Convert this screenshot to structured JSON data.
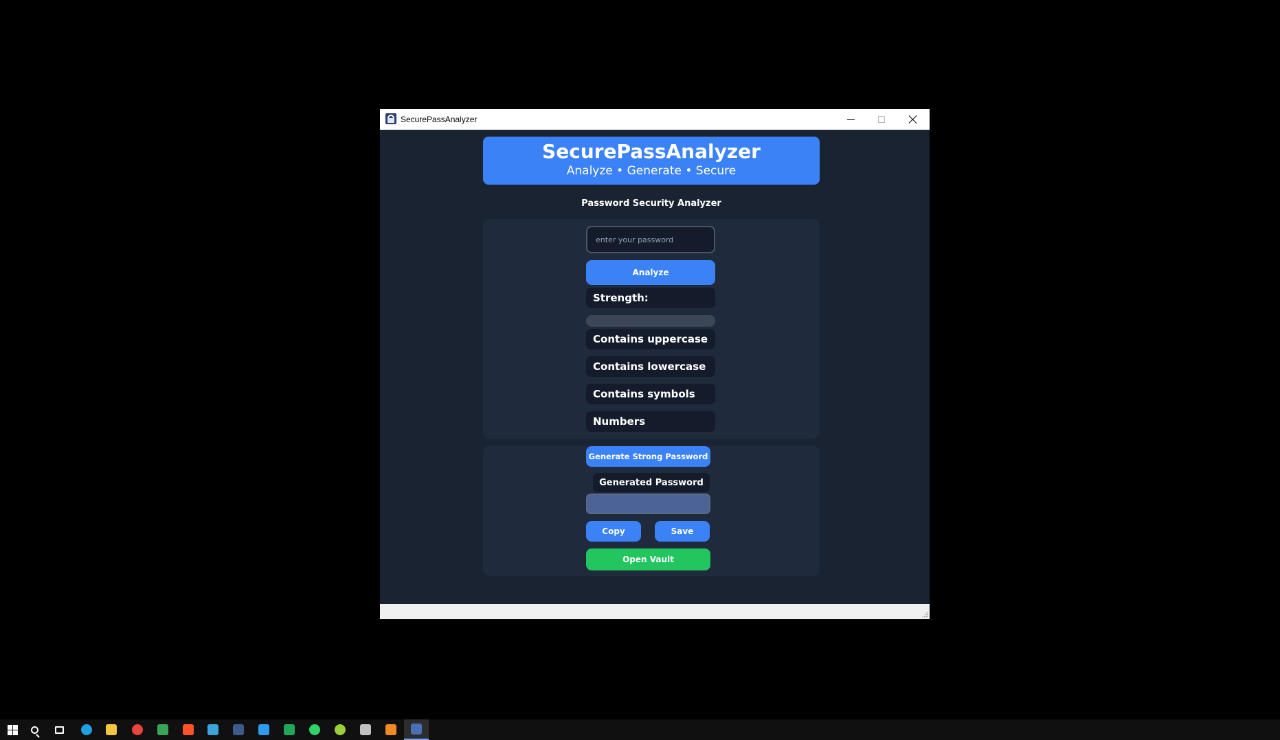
{
  "window": {
    "title": "SecurePassAnalyzer"
  },
  "header": {
    "title": "SecurePassAnalyzer",
    "subtitle": "Analyze • Generate • Secure"
  },
  "analyzer": {
    "section_title": "Password Security Analyzer",
    "password_input": {
      "value": "",
      "placeholder": "enter your password"
    },
    "analyze_label": "Analyze",
    "strength_label": "Strength:",
    "strength_fraction": 0,
    "checks": {
      "uppercase": "Contains uppercase",
      "lowercase": "Contains lowercase",
      "symbols": "Contains symbols",
      "numbers": "Numbers"
    }
  },
  "generator": {
    "generate_label": "Generate Strong Password",
    "generated_label": "Generated Password",
    "generated_value": "",
    "copy_label": "Copy",
    "save_label": "Save",
    "vault_label": "Open Vault"
  },
  "colors": {
    "accent": "#3b82f6",
    "success": "#22c55e",
    "background": "#1a2332",
    "panel": "#1f2a3c"
  },
  "taskbar": {
    "icons": [
      {
        "name": "start-icon",
        "color": "#ffffff"
      },
      {
        "name": "search-icon",
        "color": "#ffffff"
      },
      {
        "name": "task-view-icon",
        "color": "#ffffff"
      },
      {
        "name": "edge-icon",
        "color": "#1fa0e0"
      },
      {
        "name": "file-explorer-icon",
        "color": "#f5c542"
      },
      {
        "name": "chrome-icon",
        "color": "#e8453c"
      },
      {
        "name": "store-icon",
        "color": "#3aa655"
      },
      {
        "name": "brave-icon",
        "color": "#fb542b"
      },
      {
        "name": "vs-installer-icon",
        "color": "#3ea3d8"
      },
      {
        "name": "app-icon",
        "color": "#3c5a8a"
      },
      {
        "name": "vscode-icon",
        "color": "#2f9bf0"
      },
      {
        "name": "qc-icon",
        "color": "#22a65a"
      },
      {
        "name": "whatsapp-icon",
        "color": "#2fd366"
      },
      {
        "name": "green-app-icon",
        "color": "#9ccf3a"
      },
      {
        "name": "database-icon",
        "color": "#c0c0c0"
      },
      {
        "name": "orange-app-icon",
        "color": "#f08a24"
      },
      {
        "name": "securepass-taskbar-icon",
        "color": "#4a6fb5"
      }
    ]
  }
}
